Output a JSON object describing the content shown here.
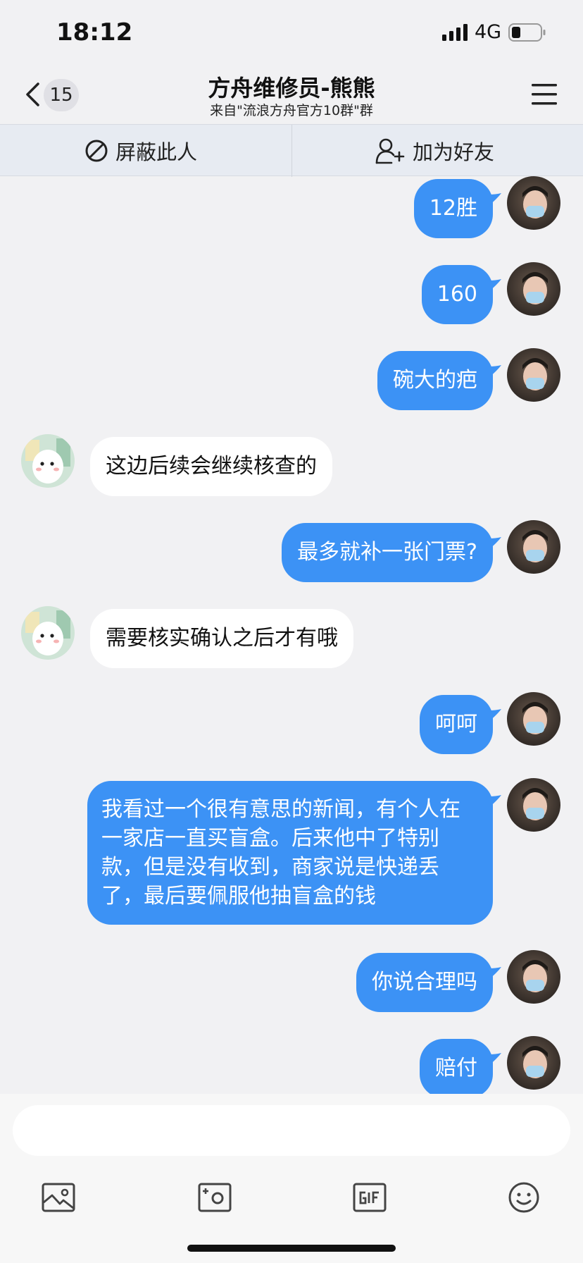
{
  "status_bar": {
    "time": "18:12",
    "network": "4G",
    "icons": [
      "signal-icon",
      "battery-icon"
    ]
  },
  "nav": {
    "unread_count": "15",
    "title": "方舟维修员-熊熊",
    "subtitle": "来自\"流浪方舟官方10群\"群",
    "icons": [
      "chevron-left-icon",
      "menu-icon"
    ]
  },
  "actions": {
    "block_label": "屏蔽此人",
    "add_friend_label": "加为好友",
    "icons": [
      "block-icon",
      "add-friend-icon"
    ]
  },
  "messages": [
    {
      "sender": "self",
      "text": "12胜"
    },
    {
      "sender": "self",
      "text": "160"
    },
    {
      "sender": "self",
      "text": "碗大的疤"
    },
    {
      "sender": "other",
      "text": "这边后续会继续核查的"
    },
    {
      "sender": "self",
      "text": "最多就补一张门票?"
    },
    {
      "sender": "other",
      "text": "需要核实确认之后才有哦"
    },
    {
      "sender": "self",
      "text": "呵呵"
    },
    {
      "sender": "self",
      "text": "我看过一个很有意思的新闻，有个人在一家店一直买盲盒。后来他中了特别款，但是没有收到，商家说是快递丢了，最后要佩服他抽盲盒的钱"
    },
    {
      "sender": "self",
      "text": "你说合理吗"
    },
    {
      "sender": "self",
      "text": "赔付"
    }
  ],
  "input": {
    "placeholder": "",
    "tools": [
      "image-icon",
      "camera-icon",
      "gif-icon",
      "emoji-icon"
    ]
  },
  "colors": {
    "self_bubble": "#3c92f5",
    "other_bubble": "#ffffff",
    "background": "#f1f1f3",
    "action_bar": "#e7ebf2"
  }
}
